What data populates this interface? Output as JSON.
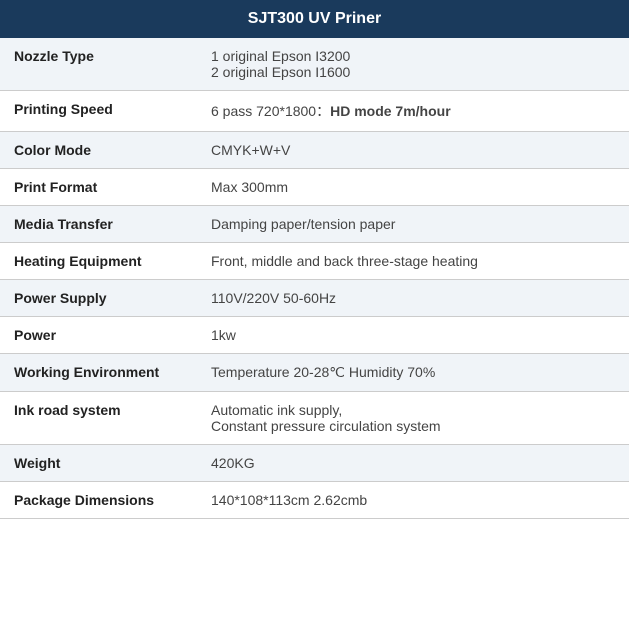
{
  "header": {
    "title": "SJT300 UV Priner"
  },
  "rows": [
    {
      "label": "Nozzle Type",
      "value": "1 original Epson I3200\n2 original Epson I1600",
      "multiline": true,
      "bold_part": null
    },
    {
      "label": "Printing Speed",
      "value": "6 pass 720*1800：",
      "value_bold": "HD mode 7m/hour",
      "multiline": false,
      "bold_part": "HD mode 7m/hour"
    },
    {
      "label": "Color Mode",
      "value": "CMYK+W+V",
      "multiline": false,
      "bold_part": null
    },
    {
      "label": "Print Format",
      "value": "Max 300mm",
      "multiline": false,
      "bold_part": null
    },
    {
      "label": "Media Transfer",
      "value": "Damping paper/tension paper",
      "multiline": false,
      "bold_part": null
    },
    {
      "label": "Heating Equipment",
      "value": "Front, middle and back three-stage heating",
      "multiline": false,
      "bold_part": null
    },
    {
      "label": "Power Supply",
      "value": "110V/220V 50-60Hz",
      "multiline": false,
      "bold_part": null
    },
    {
      "label": "Power",
      "value": "1kw",
      "multiline": false,
      "bold_part": null
    },
    {
      "label": "Working Environment",
      "value": "Temperature 20-28℃ Humidity 70%",
      "multiline": false,
      "bold_part": null
    },
    {
      "label": "Ink road system",
      "value": "Automatic ink supply,\nConstant pressure circulation system",
      "multiline": true,
      "bold_part": null
    },
    {
      "label": "Weight",
      "value": "420KG",
      "multiline": false,
      "bold_part": null
    },
    {
      "label": "Package Dimensions",
      "value": "140*108*113cm 2.62cmb",
      "multiline": false,
      "bold_part": null
    }
  ]
}
